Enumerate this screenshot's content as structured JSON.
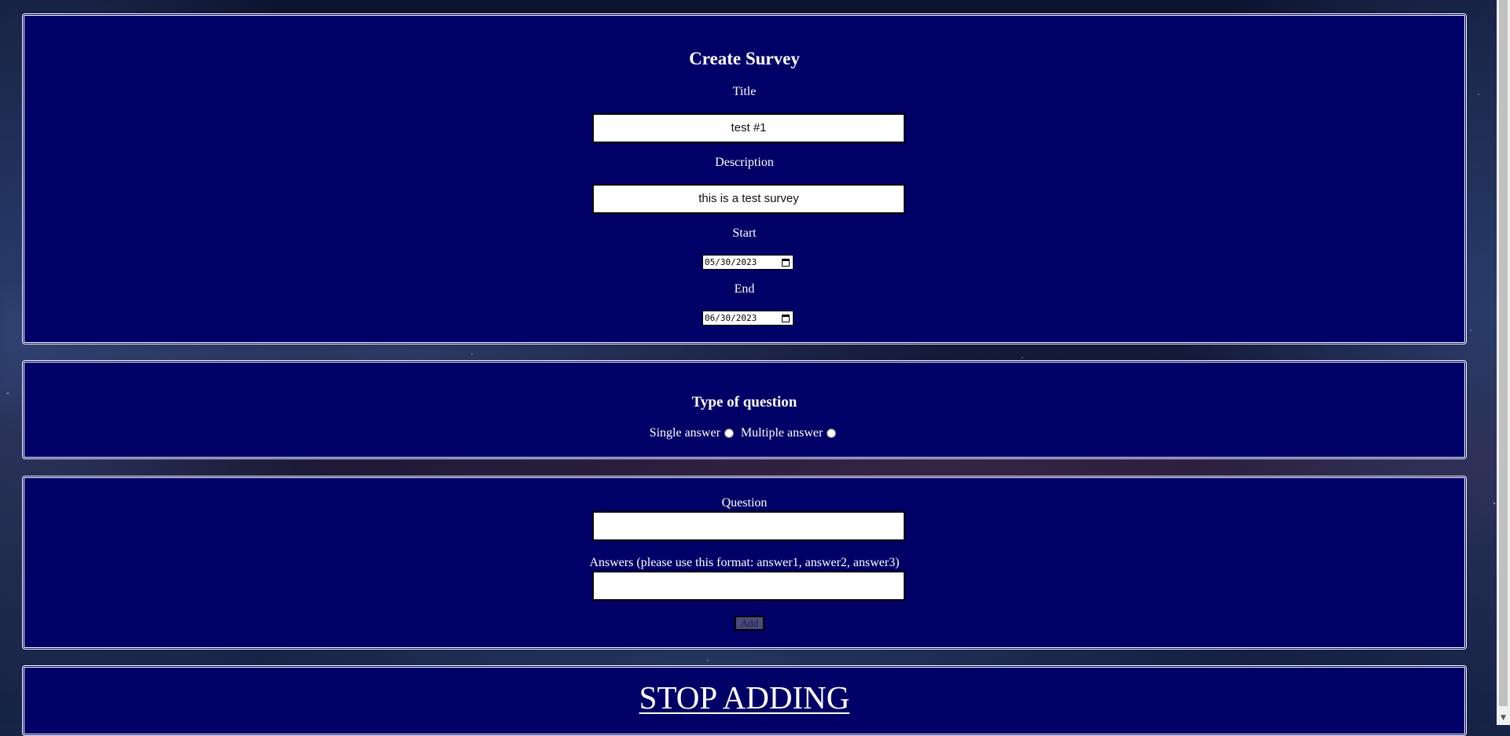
{
  "survey": {
    "heading": "Create Survey",
    "title_label": "Title",
    "title_value": "test #1",
    "description_label": "Description",
    "description_value": "this is a test survey",
    "start_label": "Start",
    "start_value": "05/30/2023",
    "end_label": "End",
    "end_value": "06/30/2023"
  },
  "question_type": {
    "heading": "Type of question",
    "single_label": "Single answer",
    "multiple_label": "Multiple answer"
  },
  "question": {
    "question_label": "Question",
    "question_value": "",
    "answers_label": "Answers (please use this format: answer1, answer2, answer3)",
    "answers_value": "",
    "add_label": "Add"
  },
  "stop": {
    "label": "STOP ADDING"
  },
  "colors": {
    "panel_bg": "#000066",
    "text": "#ffffff"
  },
  "icons": [
    "calendar-icon",
    "chevron-down-icon"
  ]
}
